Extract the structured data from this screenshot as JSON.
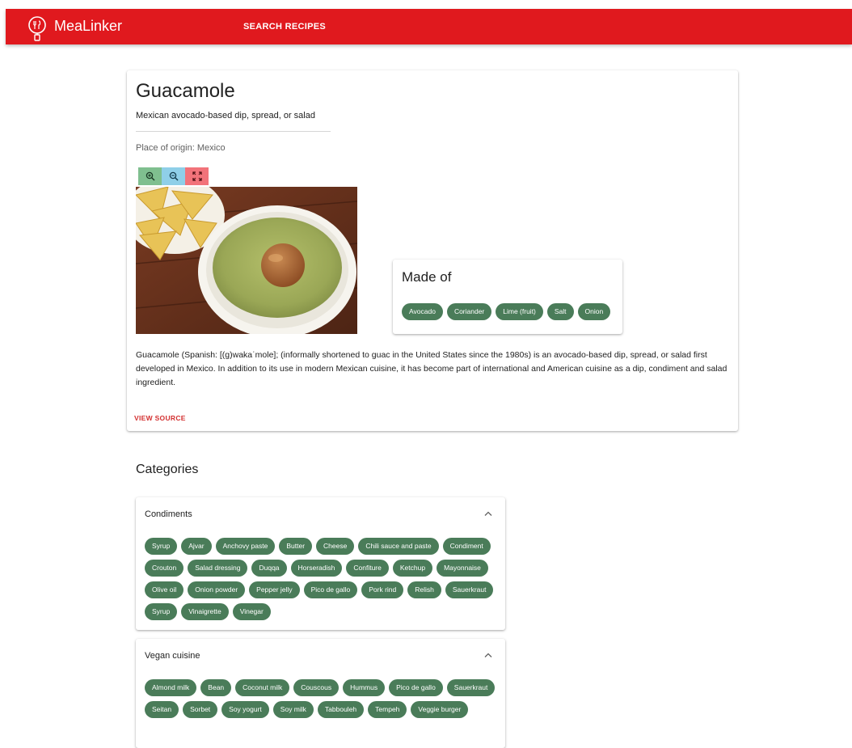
{
  "app": {
    "name": "MeaLinker",
    "nav_search": "SEARCH RECIPES"
  },
  "colors": {
    "accent": "#e0191e",
    "chip": "#4a7c59",
    "source_link": "#d32f2f"
  },
  "recipe": {
    "title": "Guacamole",
    "subtitle": "Mexican avocado-based dip, spread, or salad",
    "origin": "Place of origin: Mexico",
    "image_controls": [
      "zoom-in-icon",
      "zoom-out-icon",
      "fullscreen-icon"
    ],
    "made_of_title": "Made of",
    "ingredients": [
      "Avocado",
      "Coriander",
      "Lime (fruit)",
      "Salt",
      "Onion"
    ],
    "description": "Guacamole (Spanish: [(ɡ)wakaˈmole]; (informally shortened to guac in the United States since the 1980s) is an avocado-based dip, spread, or salad first developed in Mexico. In addition to its use in modern Mexican cuisine, it has become part of international and American cuisine as a dip, condiment and salad ingredient.",
    "view_source": "VIEW SOURCE"
  },
  "categories": {
    "heading": "Categories",
    "groups": [
      {
        "name": "Condiments",
        "items": [
          "Syrup",
          "Ajvar",
          "Anchovy paste",
          "Butter",
          "Cheese",
          "Chili sauce and paste",
          "Condiment",
          "Crouton",
          "Salad dressing",
          "Duqqa",
          "Horseradish",
          "Confiture",
          "Ketchup",
          "Mayonnaise",
          "Olive oil",
          "Onion powder",
          "Pepper jelly",
          "Pico de gallo",
          "Pork rind",
          "Relish",
          "Sauerkraut",
          "Syrup",
          "Vinaigrette",
          "Vinegar"
        ]
      },
      {
        "name": "Vegan cuisine",
        "items": [
          "Almond milk",
          "Bean",
          "Coconut milk",
          "Couscous",
          "Hummus",
          "Pico de gallo",
          "Sauerkraut",
          "Seitan",
          "Sorbet",
          "Soy yogurt",
          "Soy milk",
          "Tabbouleh",
          "Tempeh",
          "Veggie burger"
        ]
      }
    ]
  }
}
